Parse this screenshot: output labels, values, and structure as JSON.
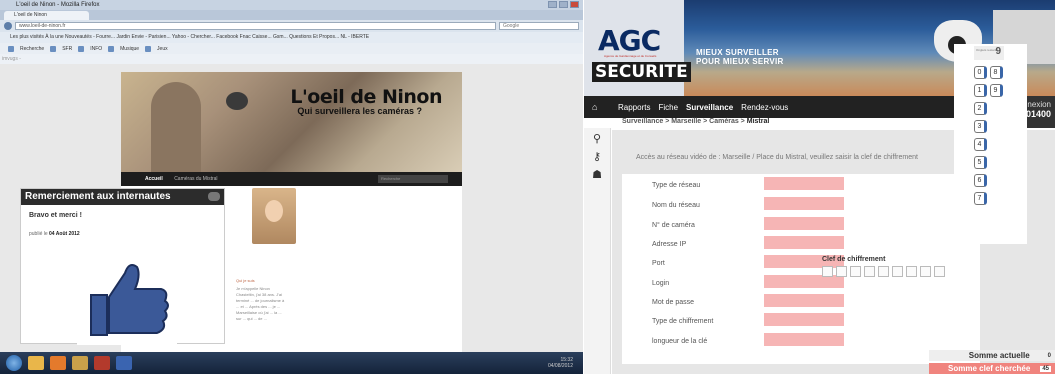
{
  "left": {
    "window_title": "L'oeil de Ninon - Mozilla Firefox",
    "tab_label": "L'oeil de Ninon",
    "url": "www.loeil-de-ninon.fr",
    "search_placeholder": "Google",
    "bookmarks": "Les plus visités  À la une  Nouveautés - Fourre...  Jardin Envie - Parisien...  Yahoo - Chercher...  Facebook  Fnac  Caisse...  Gsm...  Questions Et Propos...  NL - IBERTE",
    "toolbar_items": [
      "Recherche",
      "SFR",
      "INFO",
      "Musique",
      "Jeux"
    ],
    "toolbar2_label": "imvugs -",
    "blog": {
      "title": "L'oeil de Ninon",
      "subtitle": "Qui surveillera les caméras ?",
      "nav_active": "Accueil",
      "nav_item": "Caméras du Mistral",
      "search_placeholder": "Recherche"
    },
    "post": {
      "header": "Remerciement aux internautes",
      "title": "Bravo et merci !",
      "date_prefix": "publié le",
      "date": "04 Août 2012"
    },
    "sidebar": {
      "label": "Qui je suis",
      "text": "Je m'appelle Ninon Chasteltin, j'ai 38 ans. J'ai terminé ... de journalisme à ... et ... Après des ... je ... Marseillaise où j'ai ... la ... sur ... qui ... de ..."
    },
    "taskbar": {
      "clock": "15:32",
      "date": "04/08/2012"
    }
  },
  "right": {
    "logo": {
      "agc": "AGC",
      "tagline": "Agence de Gardiennage et de Conseils",
      "securite": "SECURITE"
    },
    "slogan_line1": "MIEUX SURVEILLER",
    "slogan_line2": "POUR MIEUX SERVIR",
    "nav": {
      "items": [
        "Rapports",
        "Fiche",
        "Surveillance",
        "Rendez-vous"
      ],
      "active": "Surveillance"
    },
    "connexion": {
      "label": "Connexion",
      "number": "0001400"
    },
    "breadcrumb_path": "Surveillance > Marseille > Caméras >",
    "breadcrumb_current": "Mistral",
    "access_text": "Accès au réseau vidéo de : Marseille / Place du Mistral, veuillez saisir la clef de chiffrement",
    "form_fields": [
      "Type de réseau",
      "Nom du réseau",
      "N° de caméra",
      "Adresse IP",
      "Port",
      "Login",
      "Mot de passe",
      "Type de chiffrement",
      "longueur de la clé"
    ],
    "clef_label": "Clef de chiffrement",
    "clef_slots": 9,
    "ores_label": "Onglets restants",
    "ores_value": "9",
    "keypad": [
      "0",
      "8",
      "1",
      "9",
      "2",
      "3",
      "4",
      "5",
      "6",
      "7"
    ],
    "somme_actuelle_label": "Somme actuelle",
    "somme_actuelle_value": "0",
    "somme_cherchee_label": "Somme clef cherchée",
    "somme_cherchee_value": "45",
    "colors": {
      "field_pink": "#f6b5b5",
      "accent_blue": "#3a66a8",
      "dark_nav": "#222222",
      "sum_red": "#f0847e"
    }
  }
}
